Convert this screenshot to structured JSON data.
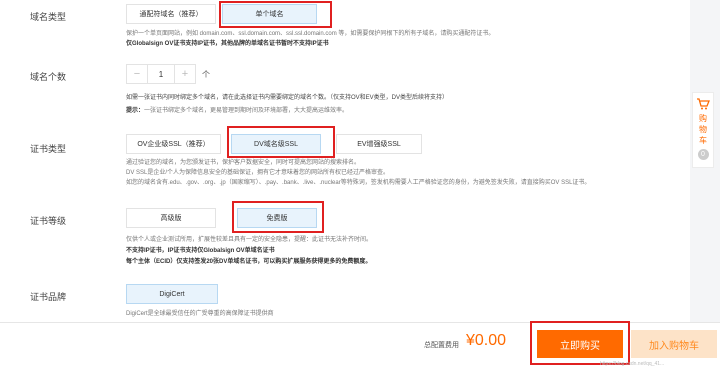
{
  "domain_type": {
    "label": "域名类型",
    "options": [
      "通配符域名（推荐）",
      "单个域名"
    ],
    "note1": "保护一个单页面网站，例如 domain.com、ssl.domain.com、ssl.ssl.domain.com 等，如需要保护同根下的所有子域名，请购买通配符证书。",
    "note2": "仅Globalsign OV证书支持IP证书，其他品牌的单域名证书暂时不支持IP证书"
  },
  "domain_count": {
    "label": "域名个数",
    "value": "1",
    "minus": "−",
    "plus": "+",
    "unit": "个",
    "note1": "如需一张证书内同时绑定多个域名，请在此选择证书内需要绑定的域名个数。（仅支持OV和EV类型，DV类型后续将支持）",
    "note2_prefix": "提示：",
    "note2_text": "一张证书绑定多个域名，更易管理到期时间及环境部署，大大提高运维效率。"
  },
  "cert_type": {
    "label": "证书类型",
    "options": [
      "OV企业级SSL（推荐）",
      "DV域名级SSL",
      "EV增强级SSL"
    ],
    "note1": "通过验证您的域名，为您颁发证书，保护客户数据安全，同时可提高您网站的搜索排名。",
    "note2": "DV SSL是企业/个人为保障信息安全的基础保证，拥有它才意味着您的网站所有权已经过严格审查。",
    "note3": "如您的域名含有.edu、.gov、.org、.jp（国家缩写）、.pay、.bank、.live、.nuclear等特殊词，签发机构需要人工严格验证您的身份，为避免签发失败，请直接购买OV SSL证书。"
  },
  "cert_level": {
    "label": "证书等级",
    "options": [
      "高级版",
      "免费版"
    ],
    "note1": "仅供个人或企业测试所用，扩展性较差且具有一定的安全隐患，提醒：此证书无法补齐时间。",
    "note2": "不支持IP证书，IP证书支持仅Globalsign OV单域名证书",
    "note3": "每个主体（ECID）仅支持签发20张DV单域名证书，可以购买扩展服务获得更多的免费额度。"
  },
  "cert_brand": {
    "label": "证书品牌",
    "option": "DigiCert",
    "note": "DigiCert是全球最受信任的广受尊重的高保障证书提供商"
  },
  "footer": {
    "total_label": "总配置费用",
    "total_value": "¥0.00",
    "buy_label": "立即购买",
    "cart_label": "加入购物车",
    "watermark": "https://blog.csdn.net/qq_41..."
  },
  "side_cart": {
    "chars": [
      "购",
      "物",
      "车"
    ],
    "count": "0"
  },
  "colors": {
    "accent_orange": "#ff6a00",
    "selected_bg": "#e8f3fc",
    "highlight_red": "#e02020"
  }
}
